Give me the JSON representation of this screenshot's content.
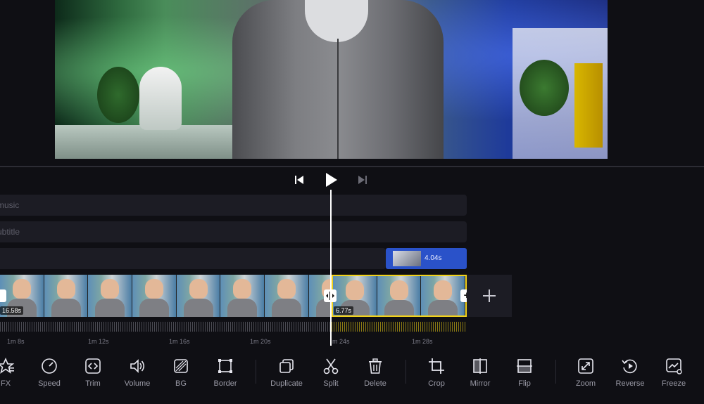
{
  "player": {
    "prev_label": "previous",
    "play_label": "play",
    "next_label": "next"
  },
  "tracks": {
    "music_label": "music",
    "subtitle_label": "ubtitle"
  },
  "overlay_clip": {
    "duration": "4.04s"
  },
  "main_clips": [
    {
      "duration": "16.58s"
    },
    {
      "duration": "6.77s"
    }
  ],
  "ruler": [
    "1m 8s",
    "1m 12s",
    "1m 16s",
    "1m 20s",
    "m 24s",
    "1m 28s"
  ],
  "toolbar": [
    {
      "label": "FX",
      "icon": "star-fx-icon"
    },
    {
      "label": "Speed",
      "icon": "speedometer-icon"
    },
    {
      "label": "Trim",
      "icon": "trim-icon"
    },
    {
      "label": "Volume",
      "icon": "speaker-icon"
    },
    {
      "label": "BG",
      "icon": "background-icon"
    },
    {
      "label": "Border",
      "icon": "border-icon"
    },
    {
      "label": "Duplicate",
      "icon": "duplicate-icon"
    },
    {
      "label": "Split",
      "icon": "scissors-icon"
    },
    {
      "label": "Delete",
      "icon": "trash-icon"
    },
    {
      "label": "Crop",
      "icon": "crop-icon"
    },
    {
      "label": "Mirror",
      "icon": "mirror-icon"
    },
    {
      "label": "Flip",
      "icon": "flip-icon"
    },
    {
      "label": "Zoom",
      "icon": "zoom-icon"
    },
    {
      "label": "Reverse",
      "icon": "reverse-icon"
    },
    {
      "label": "Freeze",
      "icon": "freeze-icon"
    }
  ],
  "colors": {
    "accent_selected": "#f2d21b",
    "overlay_clip": "#2a52c9",
    "background": "#0f0f14"
  }
}
